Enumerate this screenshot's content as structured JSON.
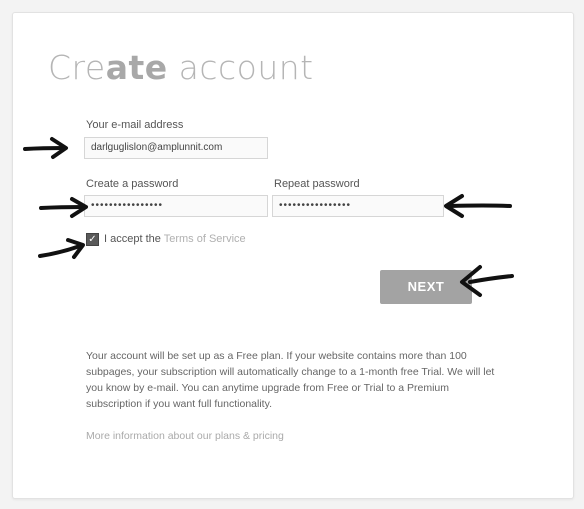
{
  "page": {
    "title_light_a": "Cre",
    "title_bold": "ate",
    "title_light_b": " account"
  },
  "form": {
    "email_label": "Your e-mail address",
    "email_value": "darlguglislon@amplunnit.com",
    "password_label": "Create a password",
    "password_value": "••••••••••••••••",
    "repeat_label": "Repeat password",
    "repeat_value": "••••••••••••••••",
    "accept_prefix": "I accept the ",
    "accept_link": "Terms of Service",
    "accept_checked": true,
    "next_label": "NEXT"
  },
  "info": {
    "text": "Your account will be set up as a Free plan. If your website contains more than 100 subpages, your subscription will automatically change to a 1-month free Trial. We will let you know by e-mail. You can anytime upgrade from Free or Trial to a Premium subscription if you want full functionality.",
    "more_link": "More information about our plans & pricing"
  },
  "colors": {
    "button": "#a3a3a3",
    "annotation_arrow": "#111111"
  },
  "annotations": [
    "arrow-icon",
    "arrow-icon",
    "arrow-icon",
    "arrow-icon",
    "arrow-icon"
  ]
}
